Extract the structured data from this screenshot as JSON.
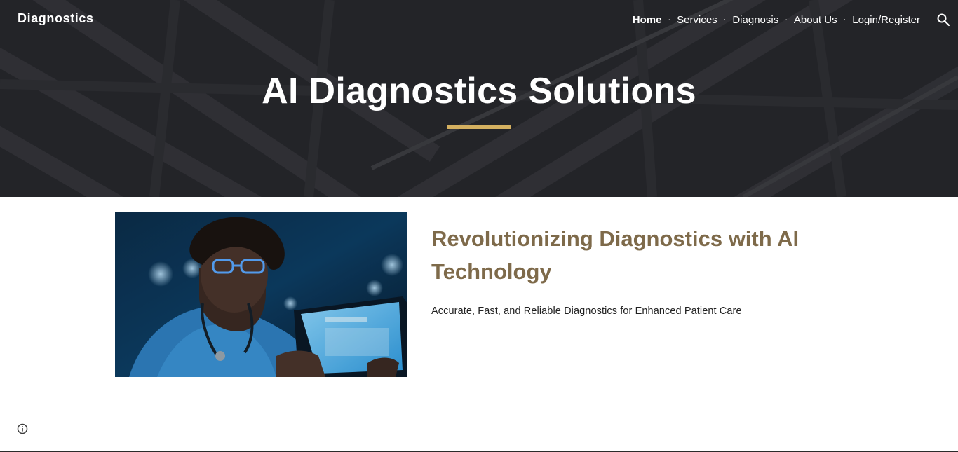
{
  "site": {
    "title": "Diagnostics"
  },
  "nav": {
    "items": [
      {
        "label": "Home",
        "active": true
      },
      {
        "label": "Services",
        "active": false
      },
      {
        "label": "Diagnosis",
        "active": false
      },
      {
        "label": "About Us",
        "active": false
      },
      {
        "label": "Login/Register",
        "active": false
      }
    ],
    "separator": "·",
    "search_icon": "search-icon"
  },
  "hero": {
    "title": "AI Diagnostics Solutions",
    "underline_color": "#d4b060"
  },
  "content": {
    "heading": "Revolutionizing Diagnostics with AI Technology",
    "subheading": "Accurate, Fast, and Reliable Diagnostics for Enhanced Patient Care",
    "heading_color": "#7e6a4a"
  },
  "footer": {
    "info_icon": "info-icon"
  }
}
